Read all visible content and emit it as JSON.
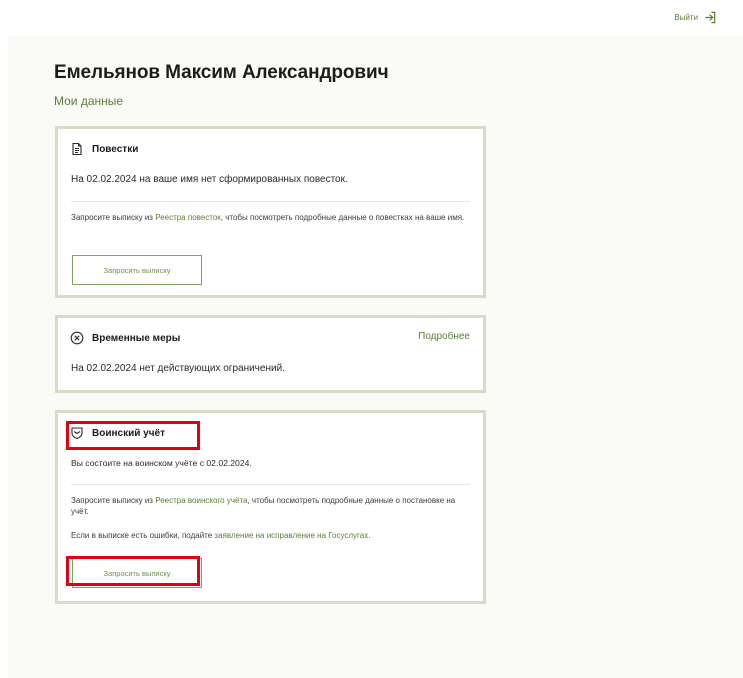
{
  "header": {
    "logout_label": "Выйти",
    "logout_icon": "logout-icon"
  },
  "profile": {
    "full_name": "Емельянов Максим Александрович",
    "my_data_link": "Мои данные"
  },
  "cards": {
    "summons": {
      "icon": "document-icon",
      "title": "Повестки",
      "status_text": "На 02.02.2024 на ваше имя нет сформированных повесток.",
      "request_prefix": "Запросите выписку из ",
      "request_link": "Реестра повесток",
      "request_suffix": ", чтобы посмотреть подробные данные о повестках на ваше имя.",
      "button_label": "Запросить выписку"
    },
    "restrictions": {
      "icon": "circle-x-icon",
      "title": "Временные меры",
      "more_link": "Подробнее",
      "status_text": "На 02.02.2024 нет действующих ограничений."
    },
    "military": {
      "icon": "shield-icon",
      "title": "Воинский учёт",
      "status_text": "Вы состоите на воинском учёте с 02.02.2024.",
      "request_prefix": "Запросите выписку из ",
      "request_link": "Реестра воинского учёта",
      "request_suffix": ", чтобы посмотреть подробные данные о постановке на учёт.",
      "errors_prefix": "Если в выписке есть ошибки, подайте ",
      "errors_link": "заявление на исправление на Госуслугах",
      "errors_suffix": ".",
      "button_label": "Запросить выписку"
    }
  },
  "colors": {
    "accent_green": "#5b7f33",
    "card_border": "#d8dbc6",
    "highlight_red": "#e0000f",
    "page_background": "#fafaf6"
  }
}
